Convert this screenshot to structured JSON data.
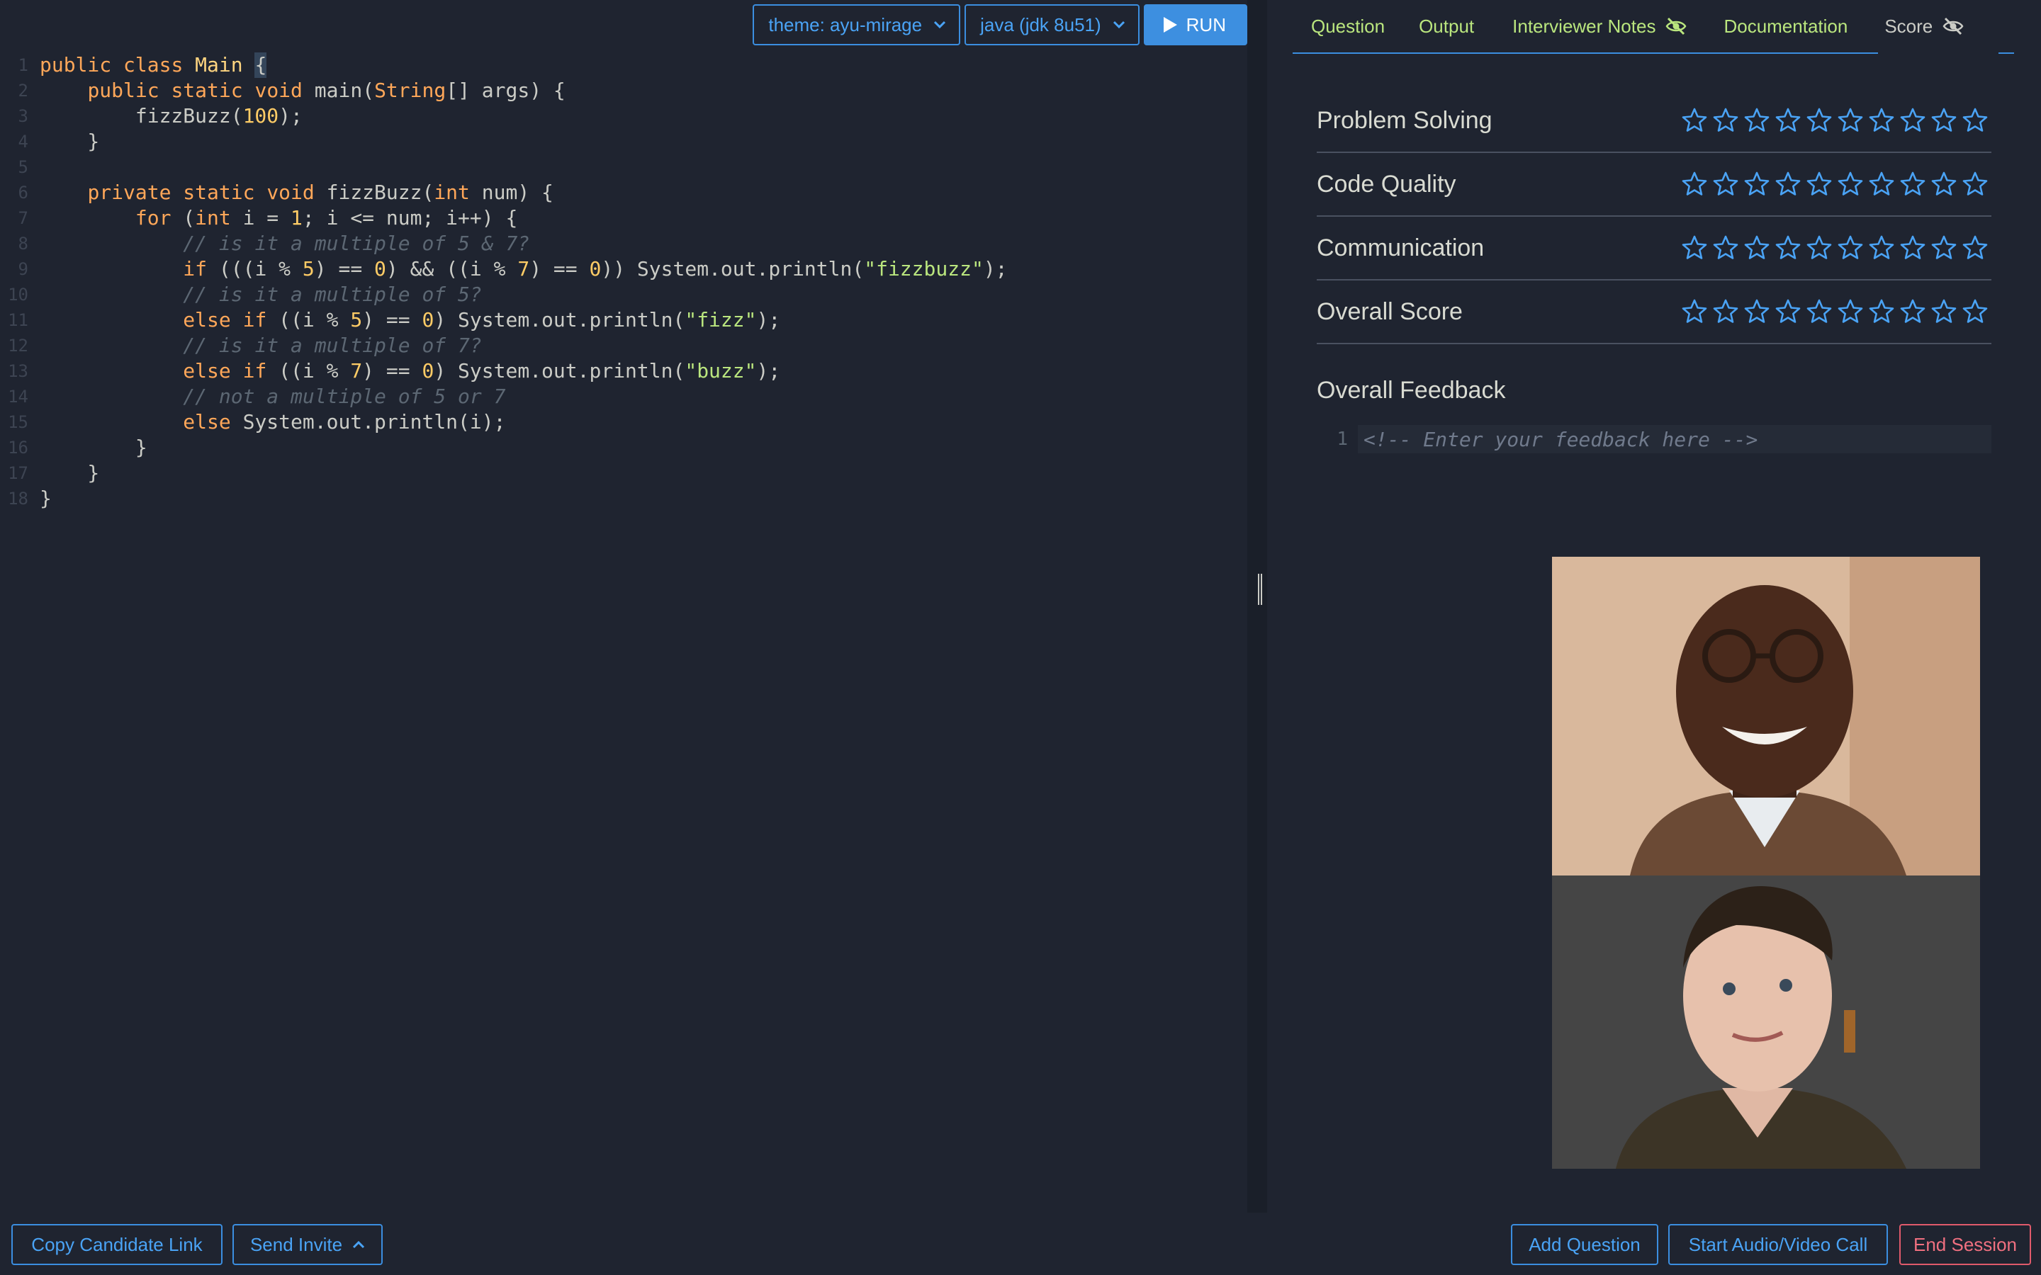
{
  "toolbar": {
    "theme_label": "theme: ayu-mirage",
    "language_label": "java (jdk 8u51)",
    "run_label": "RUN"
  },
  "editor": {
    "line_numbers": [
      "1",
      "2",
      "3",
      "4",
      "5",
      "6",
      "7",
      "8",
      "9",
      "10",
      "11",
      "12",
      "13",
      "14",
      "15",
      "16",
      "17",
      "18"
    ],
    "lines": [
      [
        {
          "t": "kw",
          "v": "public "
        },
        {
          "t": "kw",
          "v": "class "
        },
        {
          "t": "cls",
          "v": "Main "
        },
        {
          "t": "brk",
          "v": "{"
        }
      ],
      [
        {
          "t": "txt",
          "v": "    "
        },
        {
          "t": "kw",
          "v": "public "
        },
        {
          "t": "kw",
          "v": "static "
        },
        {
          "t": "kw",
          "v": "void "
        },
        {
          "t": "txt",
          "v": "main("
        },
        {
          "t": "kw",
          "v": "String"
        },
        {
          "t": "txt",
          "v": "[] args) {"
        }
      ],
      [
        {
          "t": "txt",
          "v": "        fizzBuzz("
        },
        {
          "t": "num",
          "v": "100"
        },
        {
          "t": "txt",
          "v": ");"
        }
      ],
      [
        {
          "t": "txt",
          "v": "    }"
        }
      ],
      [
        {
          "t": "txt",
          "v": ""
        }
      ],
      [
        {
          "t": "txt",
          "v": "    "
        },
        {
          "t": "kw",
          "v": "private "
        },
        {
          "t": "kw",
          "v": "static "
        },
        {
          "t": "kw",
          "v": "void "
        },
        {
          "t": "txt",
          "v": "fizzBuzz("
        },
        {
          "t": "kw",
          "v": "int "
        },
        {
          "t": "txt",
          "v": "num) {"
        }
      ],
      [
        {
          "t": "txt",
          "v": "        "
        },
        {
          "t": "kw",
          "v": "for "
        },
        {
          "t": "txt",
          "v": "("
        },
        {
          "t": "kw",
          "v": "int "
        },
        {
          "t": "txt",
          "v": "i = "
        },
        {
          "t": "num",
          "v": "1"
        },
        {
          "t": "txt",
          "v": "; i <= num; i++) {"
        }
      ],
      [
        {
          "t": "txt",
          "v": "            "
        },
        {
          "t": "cmt",
          "v": "// is it a multiple of 5 & 7?"
        }
      ],
      [
        {
          "t": "txt",
          "v": "            "
        },
        {
          "t": "kw",
          "v": "if "
        },
        {
          "t": "txt",
          "v": "(((i % "
        },
        {
          "t": "num",
          "v": "5"
        },
        {
          "t": "txt",
          "v": ") == "
        },
        {
          "t": "num",
          "v": "0"
        },
        {
          "t": "txt",
          "v": ") && ((i % "
        },
        {
          "t": "num",
          "v": "7"
        },
        {
          "t": "txt",
          "v": ") == "
        },
        {
          "t": "num",
          "v": "0"
        },
        {
          "t": "txt",
          "v": ")) System.out.println("
        },
        {
          "t": "str",
          "v": "\"fizzbuzz\""
        },
        {
          "t": "txt",
          "v": ");"
        }
      ],
      [
        {
          "t": "txt",
          "v": "            "
        },
        {
          "t": "cmt",
          "v": "// is it a multiple of 5?"
        }
      ],
      [
        {
          "t": "txt",
          "v": "            "
        },
        {
          "t": "kw",
          "v": "else if "
        },
        {
          "t": "txt",
          "v": "((i % "
        },
        {
          "t": "num",
          "v": "5"
        },
        {
          "t": "txt",
          "v": ") == "
        },
        {
          "t": "num",
          "v": "0"
        },
        {
          "t": "txt",
          "v": ") System.out.println("
        },
        {
          "t": "str",
          "v": "\"fizz\""
        },
        {
          "t": "txt",
          "v": ");"
        }
      ],
      [
        {
          "t": "txt",
          "v": "            "
        },
        {
          "t": "cmt",
          "v": "// is it a multiple of 7?"
        }
      ],
      [
        {
          "t": "txt",
          "v": "            "
        },
        {
          "t": "kw",
          "v": "else if "
        },
        {
          "t": "txt",
          "v": "((i % "
        },
        {
          "t": "num",
          "v": "7"
        },
        {
          "t": "txt",
          "v": ") == "
        },
        {
          "t": "num",
          "v": "0"
        },
        {
          "t": "txt",
          "v": ") System.out.println("
        },
        {
          "t": "str",
          "v": "\"buzz\""
        },
        {
          "t": "txt",
          "v": ");"
        }
      ],
      [
        {
          "t": "txt",
          "v": "            "
        },
        {
          "t": "cmt",
          "v": "// not a multiple of 5 or 7"
        }
      ],
      [
        {
          "t": "txt",
          "v": "            "
        },
        {
          "t": "kw",
          "v": "else "
        },
        {
          "t": "txt",
          "v": "System.out.println(i);"
        }
      ],
      [
        {
          "t": "txt",
          "v": "        }"
        }
      ],
      [
        {
          "t": "txt",
          "v": "    }"
        }
      ],
      [
        {
          "t": "txt",
          "v": "}"
        }
      ]
    ]
  },
  "tabs": [
    {
      "label": "Question",
      "icon": ""
    },
    {
      "label": "Output",
      "icon": ""
    },
    {
      "label": "Interviewer Notes",
      "icon": "eye-slash-icon"
    },
    {
      "label": "Documentation",
      "icon": ""
    },
    {
      "label": "Score",
      "icon": "eye-slash-icon",
      "active": true
    }
  ],
  "score": {
    "criteria": [
      {
        "label": "Problem Solving",
        "rating": 0,
        "max": 10
      },
      {
        "label": "Code Quality",
        "rating": 0,
        "max": 10
      },
      {
        "label": "Communication",
        "rating": 0,
        "max": 10
      },
      {
        "label": "Overall Score",
        "rating": 0,
        "max": 10
      }
    ],
    "feedback_title": "Overall Feedback",
    "feedback_line_number": "1",
    "feedback_placeholder": "<!-- Enter your feedback here -->"
  },
  "bottom": {
    "copy_link": "Copy Candidate Link",
    "send_invite": "Send Invite",
    "add_question": "Add Question",
    "start_call": "Start Audio/Video Call",
    "end_session": "End Session"
  },
  "colors": {
    "accent": "#3b8ee0",
    "tab_text": "#bae67e",
    "danger": "#e05a6b",
    "background": "#1f2430"
  }
}
